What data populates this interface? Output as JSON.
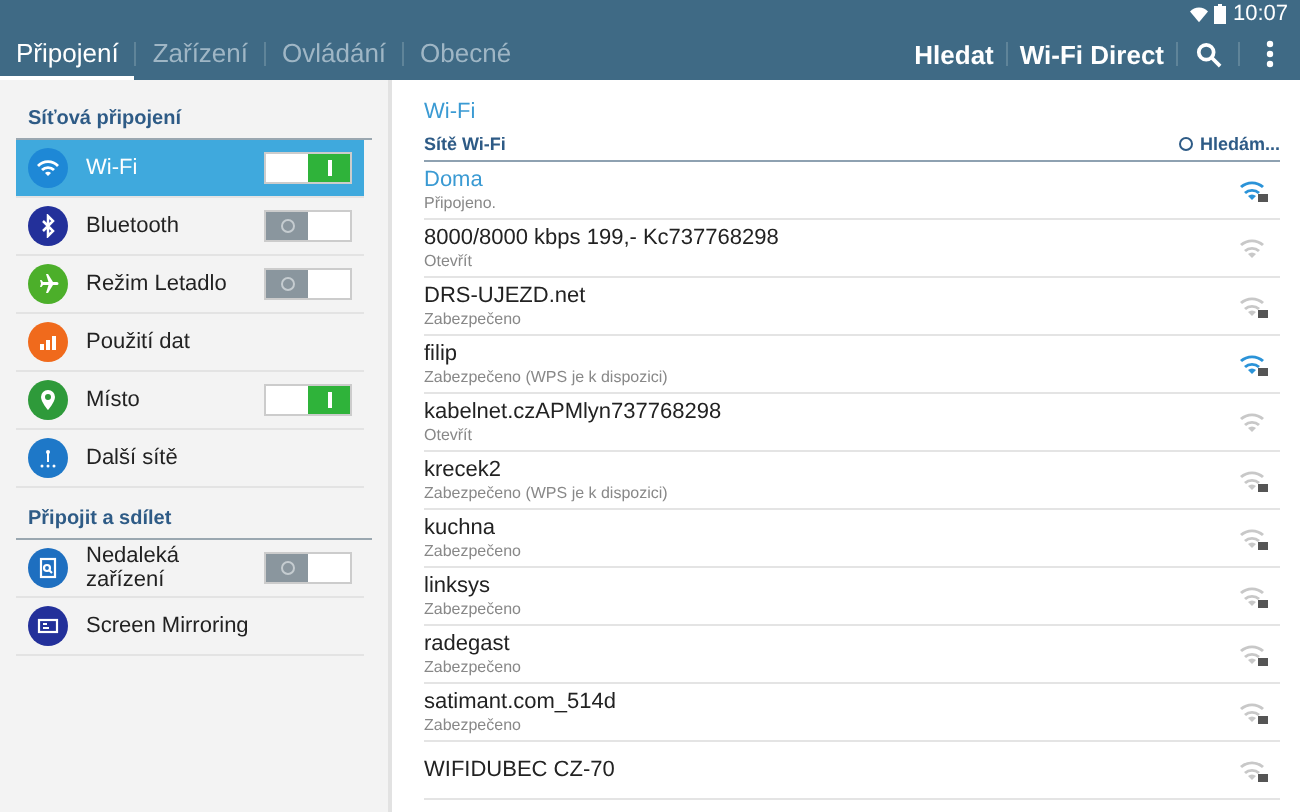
{
  "status_bar": {
    "time": "10:07"
  },
  "tabs": [
    {
      "label": "Připojení",
      "selected": true
    },
    {
      "label": "Zařízení",
      "selected": false
    },
    {
      "label": "Ovládání",
      "selected": false
    },
    {
      "label": "Obecné",
      "selected": false
    }
  ],
  "actions": [
    "Hledat",
    "Wi-Fi Direct"
  ],
  "sidebar": {
    "sections": [
      {
        "title": "Síťová připojení",
        "items": [
          {
            "label": "Wi-Fi",
            "color": "#1e88d6",
            "kind": "toggle",
            "on": true,
            "selected": true
          },
          {
            "label": "Bluetooth",
            "color": "#23309a",
            "kind": "toggle",
            "on": false,
            "selected": false
          },
          {
            "label": "Režim Letadlo",
            "color": "#4caf2a",
            "kind": "toggle",
            "on": false,
            "selected": false
          },
          {
            "label": "Použití dat",
            "color": "#f06a1c",
            "kind": "link",
            "selected": false
          },
          {
            "label": "Místo",
            "color": "#2e9a3a",
            "kind": "toggle",
            "on": true,
            "selected": false
          },
          {
            "label": "Další sítě",
            "color": "#1e78c8",
            "kind": "link",
            "selected": false
          }
        ]
      },
      {
        "title": "Připojit a sdílet",
        "items": [
          {
            "label": "Nedaleká zařízení",
            "color": "#1e6fc0",
            "kind": "toggle",
            "on": false,
            "selected": false
          },
          {
            "label": "Screen Mirroring",
            "color": "#23309a",
            "kind": "link",
            "selected": false
          }
        ]
      }
    ]
  },
  "wifi": {
    "title": "Wi-Fi",
    "list_header": "Sítě Wi-Fi",
    "scan_status": "Hledám...",
    "networks": [
      {
        "name": "Doma",
        "status": "Připojeno.",
        "connected": true,
        "locked": true,
        "highlighted": true
      },
      {
        "name": "8000/8000 kbps 199,- Kc737768298",
        "status": "Otevřít",
        "connected": false,
        "locked": false,
        "highlighted": false
      },
      {
        "name": "DRS-UJEZD.net",
        "status": "Zabezpečeno",
        "connected": false,
        "locked": true,
        "highlighted": false
      },
      {
        "name": "filip",
        "status": "Zabezpečeno (WPS je k dispozici)",
        "connected": false,
        "locked": true,
        "highlighted": true
      },
      {
        "name": "kabelnet.czAPMlyn737768298",
        "status": "Otevřít",
        "connected": false,
        "locked": false,
        "highlighted": false
      },
      {
        "name": "krecek2",
        "status": "Zabezpečeno (WPS je k dispozici)",
        "connected": false,
        "locked": true,
        "highlighted": false
      },
      {
        "name": "kuchna",
        "status": "Zabezpečeno",
        "connected": false,
        "locked": true,
        "highlighted": false
      },
      {
        "name": "linksys",
        "status": "Zabezpečeno",
        "connected": false,
        "locked": true,
        "highlighted": false
      },
      {
        "name": "radegast",
        "status": "Zabezpečeno",
        "connected": false,
        "locked": true,
        "highlighted": false
      },
      {
        "name": "satimant.com_514d",
        "status": "Zabezpečeno",
        "connected": false,
        "locked": true,
        "highlighted": false
      },
      {
        "name": "WIFIDUBEC CZ-70",
        "connected": false,
        "locked": true,
        "highlighted": false
      }
    ]
  }
}
